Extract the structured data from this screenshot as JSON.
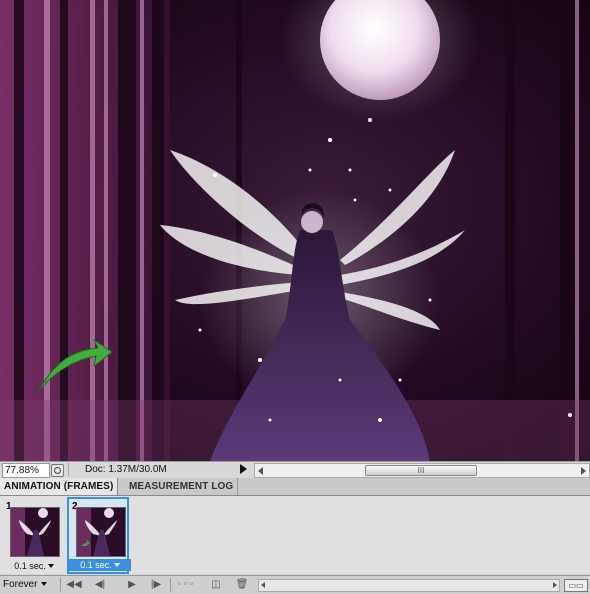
{
  "canvas": {
    "image_description_icon": "fairy-artwork",
    "colors": {
      "sky": "#1c0a1c",
      "forest": "#5b1f4a",
      "accent_pink": "#e07fc0",
      "moon": "#f3e6f3",
      "arrow": "#3fae3a"
    }
  },
  "status": {
    "zoom": "77.88%",
    "doc": "Doc: 1.37M/30.0M",
    "scroll_grip": "III"
  },
  "tabs": [
    {
      "label": "ANIMATION (FRAMES)"
    },
    {
      "label": "MEASUREMENT LOG"
    }
  ],
  "frames": [
    {
      "number": "1",
      "delay": "0.1 sec."
    },
    {
      "number": "2",
      "delay": "0.1 sec."
    }
  ],
  "toolbar": {
    "loop": "Forever",
    "first_frame_icon": "first-frame-icon",
    "prev_frame_icon": "previous-frame-icon",
    "play_icon": "play-icon",
    "next_frame_icon": "next-frame-icon",
    "tween_icon": "tween-icon",
    "duplicate_icon": "duplicate-frame-icon",
    "delete_icon": "trash-icon"
  }
}
